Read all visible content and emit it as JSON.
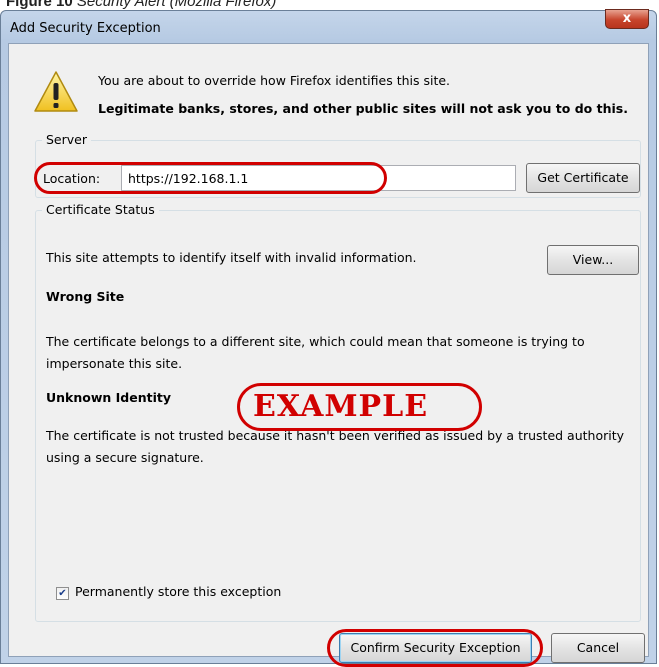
{
  "caption": {
    "figure_label": "Figure 10",
    "figure_text": "Security Alert (Mozilla Firefox)"
  },
  "dialog": {
    "title": "Add Security Exception",
    "close_label": "x",
    "message_line1": "You are about to override how Firefox identifies this site.",
    "message_line2": "Legitimate banks, stores, and other public sites will not ask you to do this.",
    "server": {
      "legend": "Server",
      "location_label": "Location:",
      "location_value": "https://192.168.1.1",
      "get_certificate_label": "Get Certificate"
    },
    "certificate_status": {
      "legend": "Certificate Status",
      "summary": "This site attempts to identify itself with invalid information.",
      "view_label": "View...",
      "wrong_site_heading": "Wrong Site",
      "wrong_site_text": "The certificate belongs to a different site, which could mean that someone is trying to impersonate this site.",
      "unknown_identity_heading": "Unknown Identity",
      "unknown_identity_text": "The certificate is not trusted because it hasn't been verified as issued by a trusted authority using a secure signature."
    },
    "permanent_store": {
      "label": "Permanently store this exception",
      "checked": true
    },
    "confirm_label": "Confirm Security Exception",
    "cancel_label": "Cancel"
  },
  "overlay": {
    "stamp": "EXAMPLE",
    "highlight_color": "#d10000"
  },
  "icons": {
    "warning": "warning-triangle-icon",
    "checkmark": "checkmark-icon"
  }
}
